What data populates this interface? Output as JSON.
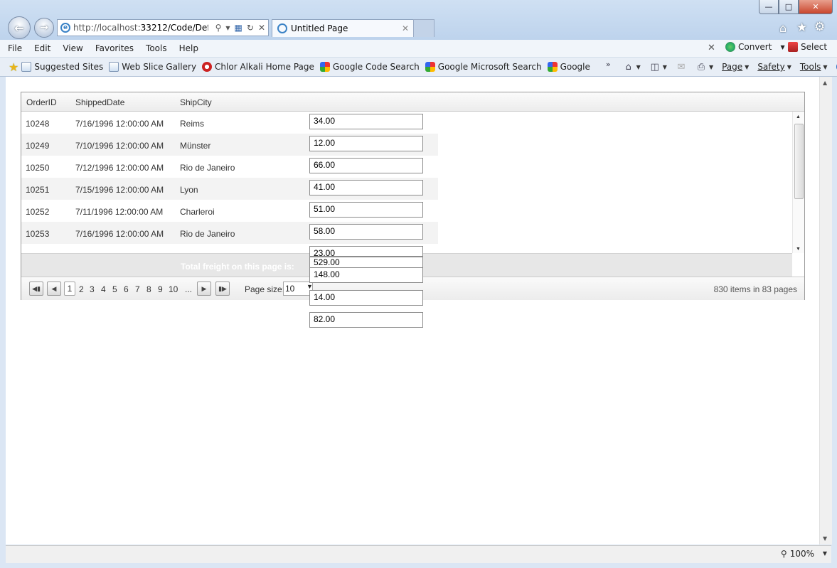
{
  "browser": {
    "address_url_host": "http://localhost:",
    "address_url_rest": "33212/Code/Defaul",
    "tab_title": "Untitled Page",
    "menu": [
      "File",
      "Edit",
      "View",
      "Favorites",
      "Tools",
      "Help"
    ],
    "convert_label": "Convert",
    "select_label": "Select",
    "favorites": [
      "Suggested Sites",
      "Web Slice Gallery",
      "Chlor Alkali Home Page",
      "Google Code Search",
      "Google Microsoft Search",
      "Google"
    ],
    "chevron": "»",
    "commands": [
      "Page",
      "Safety",
      "Tools"
    ],
    "zoom": "100%"
  },
  "grid": {
    "headers": [
      "OrderID",
      "ShippedDate",
      "ShipCity"
    ],
    "rows": [
      {
        "id": "10248",
        "date": "7/16/1996 12:00:00 AM",
        "city": "Reims"
      },
      {
        "id": "10249",
        "date": "7/10/1996 12:00:00 AM",
        "city": "Münster"
      },
      {
        "id": "10250",
        "date": "7/12/1996 12:00:00 AM",
        "city": "Rio de Janeiro"
      },
      {
        "id": "10251",
        "date": "7/15/1996 12:00:00 AM",
        "city": "Lyon"
      },
      {
        "id": "10252",
        "date": "7/11/1996 12:00:00 AM",
        "city": "Charleroi"
      },
      {
        "id": "10253",
        "date": "7/16/1996 12:00:00 AM",
        "city": "Rio de Janeiro"
      }
    ],
    "freight": [
      "34.00",
      "12.00",
      "66.00",
      "41.00",
      "51.00",
      "58.00",
      "23.00",
      "529.00",
      "148.00",
      "14.00",
      "82.00"
    ],
    "footer_label": "Total freight on this page is:",
    "pager": {
      "pages": [
        "1",
        "2",
        "3",
        "4",
        "5",
        "6",
        "7",
        "8",
        "9",
        "10",
        "..."
      ],
      "page_size_label": "Page size:",
      "page_size": "10",
      "info": "830 items in 83 pages"
    }
  }
}
